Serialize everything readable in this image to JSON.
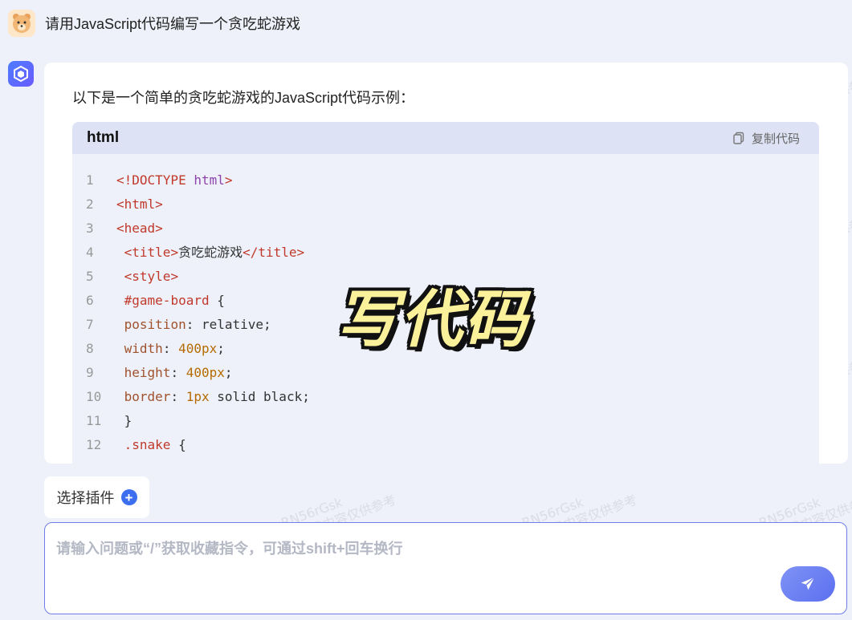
{
  "user_question": "请用JavaScript代码编写一个贪吃蛇游戏",
  "answer": {
    "intro": "以下是一个简单的贪吃蛇游戏的JavaScript代码示例：",
    "code_block": {
      "language": "html",
      "copy_label": "复制代码",
      "lines": [
        {
          "n": "1",
          "code": "<!DOCTYPE html>"
        },
        {
          "n": "2",
          "code": "<html>"
        },
        {
          "n": "3",
          "code": "<head>"
        },
        {
          "n": "4",
          "code": " <title>贪吃蛇游戏</title>"
        },
        {
          "n": "5",
          "code": " <style>"
        },
        {
          "n": "6",
          "code": " #game-board {"
        },
        {
          "n": "7",
          "code": " position: relative;"
        },
        {
          "n": "8",
          "code": " width: 400px;"
        },
        {
          "n": "9",
          "code": " height: 400px;"
        },
        {
          "n": "10",
          "code": " border: 1px solid black;"
        },
        {
          "n": "11",
          "code": " }"
        },
        {
          "n": "12",
          "code": " .snake {"
        }
      ]
    }
  },
  "overlay_caption": "写代码",
  "watermark": {
    "line1": "RN56rGsk",
    "line2": "AI生成内容仅供参考"
  },
  "plugin_button_label": "选择插件",
  "input": {
    "placeholder": "请输入问题或“/”获取收藏指令，可通过shift+回车换行",
    "value": ""
  },
  "colors": {
    "accent": "#3d6ef0",
    "input_border": "#6f7de8",
    "send_button": "#6f7ff2",
    "overlay_text": "#fbf19a"
  }
}
